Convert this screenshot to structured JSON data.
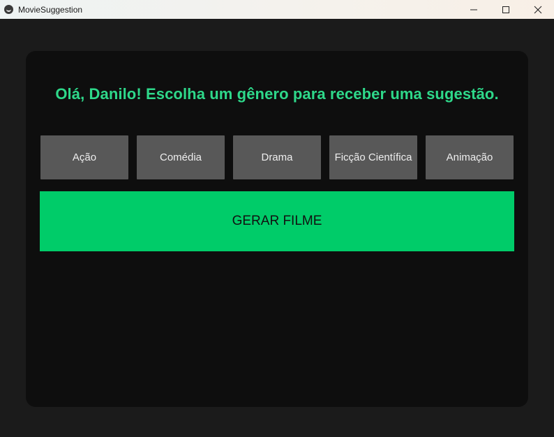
{
  "window": {
    "title": "MovieSuggestion",
    "controls": [
      "minimize",
      "maximize",
      "close"
    ]
  },
  "main": {
    "greeting": "Olá, Danilo! Escolha um gênero para receber uma sugestão.",
    "genres": [
      "Ação",
      "Comédia",
      "Drama",
      "Ficção Científica",
      "Animação"
    ],
    "generate_label": "GERAR FILME"
  },
  "colors": {
    "background": "#1b1b1b",
    "card": "#0e0e0e",
    "accent_text": "#2ed88a",
    "genre_button": "#585858",
    "generate_button": "#00cc69"
  }
}
